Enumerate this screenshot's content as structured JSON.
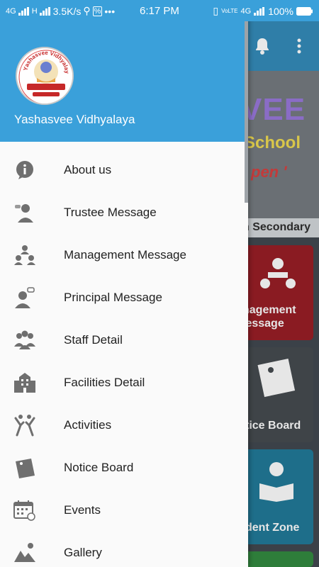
{
  "status_bar": {
    "network_left": "4G",
    "network_mid": "H",
    "speed": "3.5K/s",
    "time": "6:17 PM",
    "volte": "VoLTE",
    "network_right": "4G",
    "battery": "100%"
  },
  "drawer": {
    "school_name": "Yashasvee Vidhyalaya",
    "logo_text_top": "Yashasvee Vidhyalaya",
    "items": [
      {
        "label": "About us",
        "icon": "info-icon"
      },
      {
        "label": "Trustee Message",
        "icon": "trustee-icon"
      },
      {
        "label": "Management Message",
        "icon": "management-icon"
      },
      {
        "label": "Principal Message",
        "icon": "principal-icon"
      },
      {
        "label": "Staff Detail",
        "icon": "staff-icon"
      },
      {
        "label": "Facilities Detail",
        "icon": "building-icon"
      },
      {
        "label": "Activities",
        "icon": "activities-icon"
      },
      {
        "label": "Notice Board",
        "icon": "notice-icon"
      },
      {
        "label": "Events",
        "icon": "calendar-icon"
      },
      {
        "label": "Gallery",
        "icon": "gallery-icon"
      }
    ]
  },
  "background": {
    "banner_title": "VEE",
    "banner_subtitle": "School",
    "banner_tagline": "pen '",
    "banner_strip": "h Secondary",
    "tiles": [
      {
        "label": "nagement\nlessage",
        "color": "#8a1b22"
      },
      {
        "label": "tice Board",
        "color": "#3f4448"
      },
      {
        "label": "dent Zone",
        "color": "#1e6e8a"
      }
    ]
  },
  "colors": {
    "primary": "#3aa0da",
    "drawer_bg": "#fafafa",
    "icon_gray": "#6f6f6f"
  }
}
